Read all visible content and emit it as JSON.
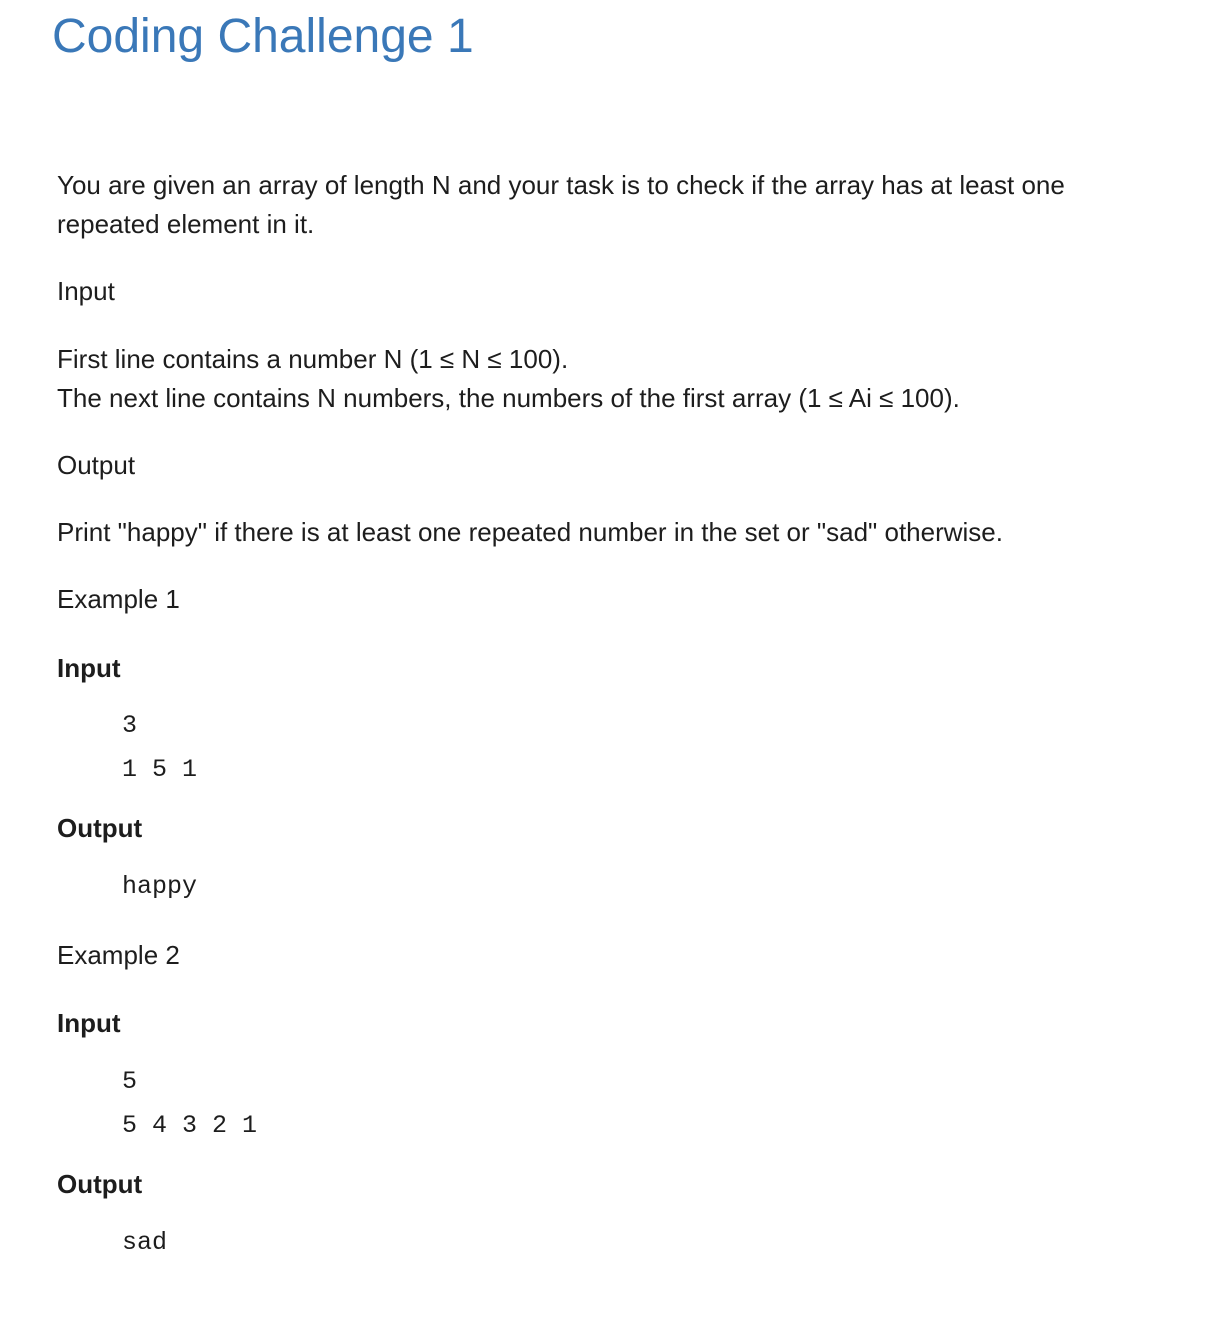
{
  "title": "Coding Challenge 1",
  "description": {
    "line1": "You are given an array of length N and your task is to check if the array has at least one",
    "line2": "repeated element in it."
  },
  "input_section": {
    "heading": "Input",
    "line1": "First line contains a number N (1 ≤ N ≤ 100).",
    "line2": "The next line contains N numbers, the numbers of the first array (1 ≤ Ai ≤ 100)."
  },
  "output_section": {
    "heading": "Output",
    "text": "Print \"happy\" if there is at least one repeated number in the set or \"sad\" otherwise."
  },
  "examples": [
    {
      "heading": "Example 1",
      "input_label": "Input",
      "input_lines": [
        "3",
        "1 5 1"
      ],
      "output_label": "Output",
      "output_lines": [
        "happy"
      ]
    },
    {
      "heading": "Example 2",
      "input_label": "Input",
      "input_lines": [
        "5",
        "5 4 3 2 1"
      ],
      "output_label": "Output",
      "output_lines": [
        "sad"
      ]
    }
  ]
}
